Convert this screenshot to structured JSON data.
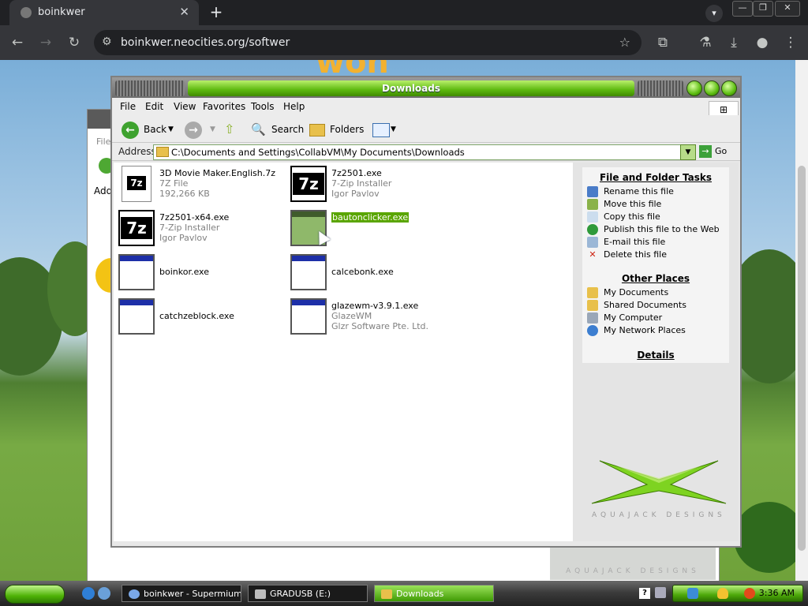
{
  "browser": {
    "tab_title": "boinkwer",
    "url": "boinkwer.neocities.org/softwer"
  },
  "page": {
    "banner_text": "won",
    "back_window": {
      "menu_fragment": "File",
      "address_fragment": "Addr",
      "logo_text": "AQUAJACK DESIGNS"
    }
  },
  "explorer": {
    "title": "Downloads",
    "menu": [
      "File",
      "Edit",
      "View",
      "Favorites",
      "Tools",
      "Help"
    ],
    "toolbar": {
      "back": "Back",
      "search": "Search",
      "folders": "Folders"
    },
    "address": {
      "label": "Address",
      "path": "C:\\Documents and Settings\\CollabVM\\My Documents\\Downloads",
      "go": "Go"
    },
    "files": [
      {
        "name": "3D Movie Maker.English.7z",
        "line2": "7Z File",
        "line3": "192,266 KB",
        "icon": "7z-archive-icon"
      },
      {
        "name": "7z2501.exe",
        "line2": "7-Zip Installer",
        "line3": "Igor Pavlov",
        "icon": "7zip-installer-icon"
      },
      {
        "name": "7z2501-x64.exe",
        "line2": "7-Zip Installer",
        "line3": "Igor Pavlov",
        "icon": "7zip-installer-icon"
      },
      {
        "name": "bautonclicker.exe",
        "line2": "",
        "line3": "",
        "icon": "application-icon",
        "selected": true
      },
      {
        "name": "boinkor.exe",
        "line2": "",
        "line3": "",
        "icon": "application-icon"
      },
      {
        "name": "calcebonk.exe",
        "line2": "",
        "line3": "",
        "icon": "application-icon"
      },
      {
        "name": "catchzeblock.exe",
        "line2": "",
        "line3": "",
        "icon": "application-icon"
      },
      {
        "name": "glazewm-v3.9.1.exe",
        "line2": "GlazeWM",
        "line3": "Glzr Software Pte. Ltd.",
        "icon": "application-icon"
      }
    ],
    "tasks": {
      "file_folder": {
        "title": "File and Folder Tasks",
        "items": [
          "Rename this file",
          "Move this file",
          "Copy this file",
          "Publish this file to the Web",
          "E-mail this file",
          "Delete this file"
        ]
      },
      "other_places": {
        "title": "Other Places",
        "items": [
          "My Documents",
          "Shared Documents",
          "My Computer",
          "My Network Places"
        ]
      },
      "details": {
        "title": "Details"
      }
    },
    "logo_text": "AQUAJACK DESIGNS"
  },
  "taskbar": {
    "tasks": [
      {
        "label": "boinkwer - Supermium"
      },
      {
        "label": "GRADUSB (E:)"
      },
      {
        "label": "Downloads"
      }
    ],
    "clock": "3:36 AM"
  },
  "colors": {
    "accent_green": "#5cb80e",
    "selection": "#5aa500",
    "browser_dark": "#202124"
  }
}
